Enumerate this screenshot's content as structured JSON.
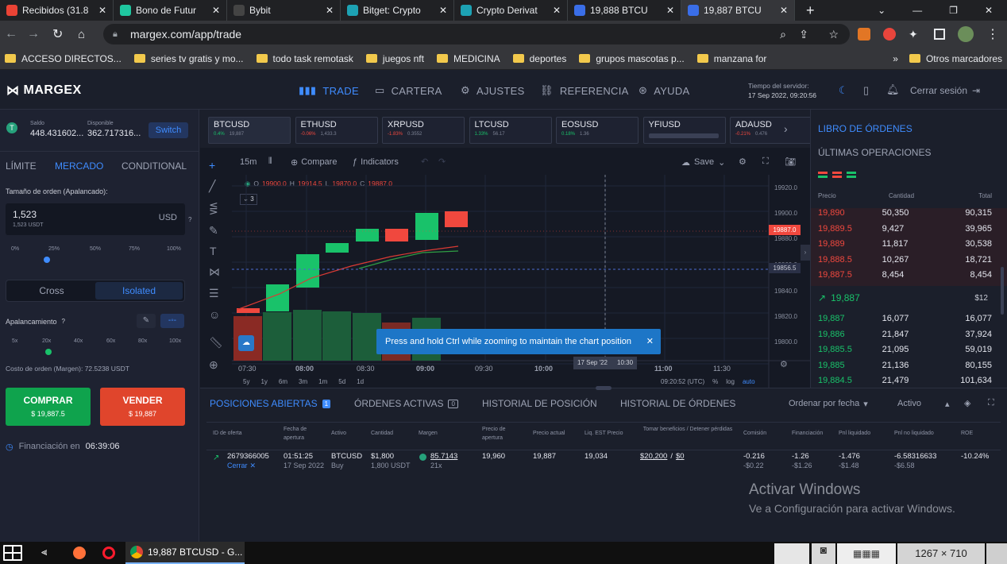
{
  "browser": {
    "tabs": [
      "Recibidos (31.8",
      "Bono de Futur",
      "Bybit",
      "Bitget: Crypto",
      "Crypto Derivat",
      "19,888 BTCU",
      "19,887 BTCU"
    ],
    "url": "margex.com/app/trade",
    "bookmarks": [
      "ACCESO DIRECTOS...",
      "series tv gratis y mo...",
      "todo task remotask",
      "juegos nft",
      "MEDICINA",
      "deportes",
      "grupos mascotas p...",
      "manzana for",
      "Otros marcadores"
    ]
  },
  "header": {
    "logo": "MARGEX",
    "nav": [
      "TRADE",
      "CARTERA",
      "AJUSTES",
      "REFERENCIA",
      "AYUDA"
    ],
    "server_time_label": "Tiempo del servidor:",
    "server_time": "17 Sep 2022, 09:20:56",
    "logout": "Cerrar sesión"
  },
  "left": {
    "balance_label": "Saldo",
    "balance": "448.431602...",
    "available_label": "Disponible",
    "available": "362.717316...",
    "switch": "Switch",
    "order_tabs": [
      "LÍMITE",
      "MERCADO",
      "CONDITIONAL"
    ],
    "size_label": "Tamaño de orden (Apalancado):",
    "size_value": "1,523",
    "size_sub": "1,523 USDT",
    "size_unit": "USD",
    "percents": [
      "0%",
      "25%",
      "50%",
      "75%",
      "100%"
    ],
    "margin_modes": [
      "Cross",
      "Isolated"
    ],
    "leverage_label": "Apalancamiento",
    "leverages": [
      "5x",
      "20x",
      "40x",
      "60x",
      "80x",
      "100x"
    ],
    "cost": "Costo de orden (Margen): 72.5238 USDT",
    "buy": "COMPRAR",
    "buy_price": "$ 19,887.5",
    "sell": "VENDER",
    "sell_price": "$ 19,887",
    "funding_label": "Financiación en",
    "funding_time": "06:39:06"
  },
  "tickers": [
    {
      "s": "BTCUSD",
      "c": "0.4%",
      "p": "19,887",
      "up": true
    },
    {
      "s": "ETHUSD",
      "c": "-0.06%",
      "p": "1,433.3",
      "up": false
    },
    {
      "s": "XRPUSD",
      "c": "-1.83%",
      "p": "0.3552",
      "up": false
    },
    {
      "s": "LTCUSD",
      "c": "1.33%",
      "p": "56.17",
      "up": true
    },
    {
      "s": "EOSUSD",
      "c": "0.18%",
      "p": "1.36",
      "up": true
    },
    {
      "s": "YFIUSD",
      "c": "",
      "p": "",
      "up": true
    },
    {
      "s": "ADAUSD",
      "c": "-0.21%",
      "p": "0.476",
      "up": false
    }
  ],
  "chart": {
    "interval": "15m",
    "compare": "Compare",
    "indicators": "Indicators",
    "save": "Save",
    "ohlc": {
      "o": "19900.0",
      "h": "19914.5",
      "l": "19870.0",
      "c": "19887.0"
    },
    "study_count": "3",
    "price_tag": "19887.0",
    "last_line": "19856.5",
    "yticks": [
      "19920.0",
      "19900.0",
      "19880.0",
      "19860.0",
      "19840.0",
      "19820.0",
      "19800.0"
    ],
    "xticks": [
      "07:30",
      "08:00",
      "08:30",
      "09:00",
      "09:30",
      "10:00",
      "11:00",
      "11:30"
    ],
    "cross_date": "17 Sep '22",
    "cross_time": "10:30",
    "tooltip": "Press and hold Ctrl while zooming to maintain the chart position",
    "ranges": [
      "5y",
      "1y",
      "6m",
      "3m",
      "1m",
      "5d",
      "1d"
    ],
    "clock": "09:20:52 (UTC)",
    "scale": [
      "%",
      "log",
      "auto"
    ]
  },
  "orderbook": {
    "title": "LIBRO DE ÓRDENES",
    "trades": "ÚLTIMAS OPERACIONES",
    "headers": [
      "Precio",
      "Cantidad",
      "Total"
    ],
    "asks": [
      [
        "19,890",
        "50,350",
        "90,315"
      ],
      [
        "19,889.5",
        "9,427",
        "39,965"
      ],
      [
        "19,889",
        "11,817",
        "30,538"
      ],
      [
        "19,888.5",
        "10,267",
        "18,721"
      ],
      [
        "19,887.5",
        "8,454",
        "8,454"
      ]
    ],
    "last": "19,887",
    "spread": "$12",
    "bids": [
      [
        "19,887",
        "16,077",
        "16,077"
      ],
      [
        "19,886",
        "21,847",
        "37,924"
      ],
      [
        "19,885.5",
        "21,095",
        "59,019"
      ],
      [
        "19,885",
        "21,136",
        "80,155"
      ],
      [
        "19,884.5",
        "21,479",
        "101,634"
      ]
    ]
  },
  "positions": {
    "tabs": [
      "POSICIONES ABIERTAS",
      "ÓRDENES ACTIVAS",
      "HISTORIAL DE POSICIÓN",
      "HISTORIAL DE ÓRDENES"
    ],
    "open_count": "1",
    "active_count": "0",
    "sort": "Ordenar por fecha",
    "active": "Activo",
    "headers": [
      "ID de oferta",
      "Fecha de apertura",
      "Activo",
      "Cantidad",
      "Margen",
      "Precio de apertura",
      "Precio actual",
      "Liq. EST Precio",
      "Tomar beneficios / Detener pérdidas",
      "Comisión",
      "Financiación",
      "Pnl liquidado",
      "Pnl no liquidado",
      "ROE"
    ],
    "row": {
      "id": "2679366005",
      "close": "Cerrar",
      "time": "01:51:25",
      "date": "17 Sep 2022",
      "asset": "BTCUSD",
      "side": "Buy",
      "qty": "$1,800",
      "qty2": "1,800 USDT",
      "margin": "85.7143",
      "lev": "21x",
      "open": "19,960",
      "current": "19,887",
      "liq": "19,034",
      "tp": "$20,200",
      "sl": "$0",
      "fee": "-0.216",
      "fee2": "-$0.22",
      "fin": "-1.26",
      "fin2": "-$1.26",
      "pnl": "-1.476",
      "pnl2": "-$1.48",
      "upnl": "-6.58316633",
      "upnl2": "-$6.58",
      "roe": "-10.24%"
    }
  },
  "watermark": {
    "title": "Activar Windows",
    "sub": "Ve a Configuración para activar Windows."
  },
  "taskbar": {
    "app": "19,887 BTCUSD - G...",
    "dims": "1267 × 710"
  }
}
